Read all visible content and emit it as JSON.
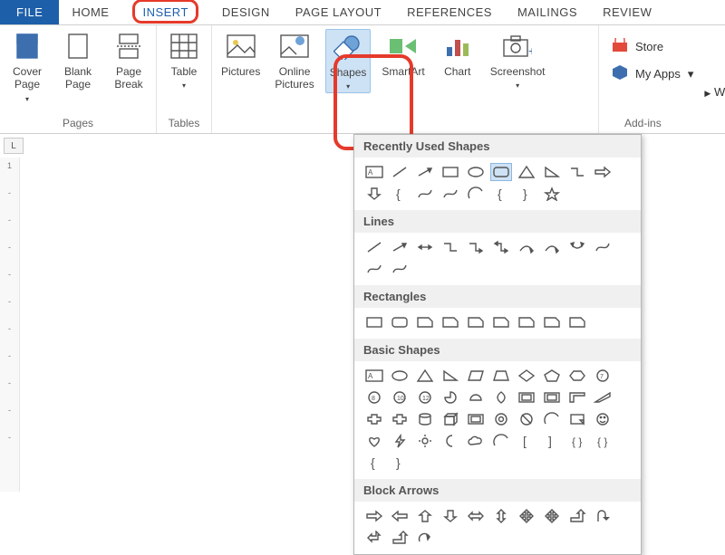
{
  "tabs": {
    "file": "FILE",
    "home": "HOME",
    "insert": "INSERT",
    "design": "DESIGN",
    "page_layout": "PAGE LAYOUT",
    "references": "REFERENCES",
    "mailings": "MAILINGS",
    "review": "REVIEW"
  },
  "ribbon": {
    "pages": {
      "cover_page": "Cover\nPage",
      "blank_page": "Blank\nPage",
      "page_break": "Page\nBreak",
      "caption": "Pages"
    },
    "tables": {
      "table": "Table",
      "caption": "Tables"
    },
    "illustrations": {
      "pictures": "Pictures",
      "online_pictures": "Online\nPictures",
      "shapes": "Shapes",
      "smartart": "SmartArt",
      "chart": "Chart",
      "screenshot": "Screenshot"
    },
    "addins": {
      "store": "Store",
      "my_apps": "My Apps",
      "wikipedia": "Wil",
      "caption": "Add-ins"
    }
  },
  "ruler": {
    "L": "L",
    "marks": [
      "1"
    ]
  },
  "shapes_panel": {
    "recently_used": {
      "title": "Recently Used Shapes",
      "items": [
        "text-box",
        "line",
        "line-arrow",
        "rectangle",
        "oval",
        "rounded-rect",
        "triangle",
        "right-triangle",
        "elbow",
        "right-arrow",
        "down-arrow",
        "left-brace-alt",
        "curve",
        "freeform",
        "arc",
        "left-brace",
        "right-brace",
        "star"
      ]
    },
    "lines": {
      "title": "Lines",
      "items": [
        "line",
        "line-arrow",
        "double-arrow",
        "elbow",
        "elbow-arrow",
        "elbow-double",
        "curve-conn",
        "curve-arrow",
        "curve-double",
        "scribble1",
        "scribble2",
        "scribble3"
      ]
    },
    "rectangles": {
      "title": "Rectangles",
      "items": [
        "rect",
        "round-rect",
        "snip1",
        "snip2",
        "snip-round",
        "round1",
        "round2",
        "round-diag",
        "half-round"
      ]
    },
    "basic_shapes": {
      "title": "Basic Shapes",
      "items": [
        "text-box",
        "oval",
        "triangle",
        "right-triangle",
        "parallelogram",
        "trapezoid",
        "diamond",
        "pentagon",
        "hexagon",
        "heptagon",
        "octagon",
        "decagon",
        "dodecagon",
        "pie",
        "chord",
        "teardrop",
        "frame",
        "half-frame",
        "L-shape",
        "diag-stripe",
        "cross",
        "plaque",
        "can",
        "cube",
        "bevel",
        "donut",
        "no-symbol",
        "arc",
        "folded-corner",
        "smiley",
        "heart",
        "lightning",
        "sun",
        "moon",
        "cloud",
        "arc2",
        "bracket1",
        "bracket2",
        "brace1",
        "brace2",
        "left-brace",
        "right-brace"
      ]
    },
    "block_arrows": {
      "title": "Block Arrows",
      "items": [
        "right",
        "left",
        "up",
        "down",
        "left-right",
        "up-down",
        "quad",
        "3way",
        "bent",
        "uturn",
        "left-up",
        "bent-up",
        "curved-r"
      ]
    }
  }
}
